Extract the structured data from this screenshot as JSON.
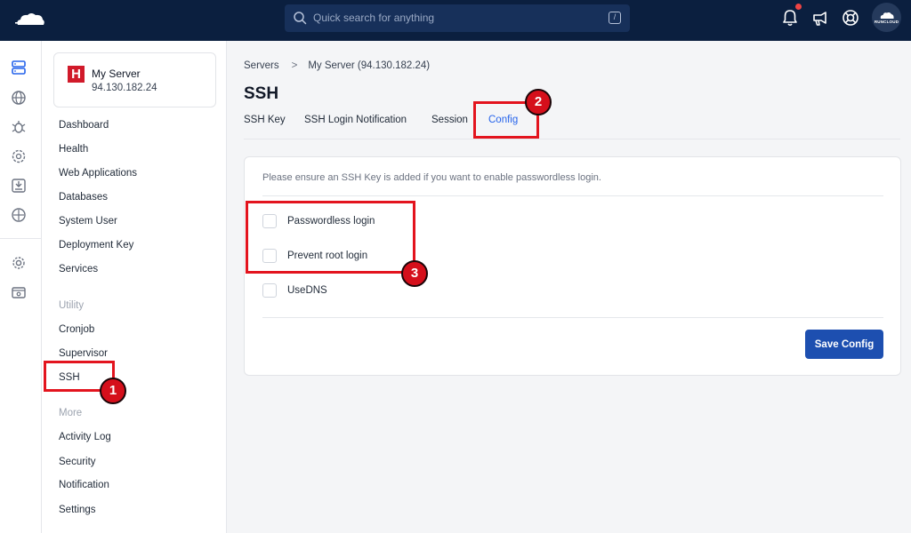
{
  "topbar": {
    "search_placeholder": "Quick search for anything",
    "search_shortcut": "/",
    "avatar_text": "RUNCLOUD",
    "notification_dot_color": "#ef4444"
  },
  "server": {
    "name": "My Server",
    "ip": "94.130.182.24",
    "logo_letter": "H",
    "logo_color": "#d11a2a"
  },
  "sidebar": {
    "items": [
      {
        "label": "Dashboard"
      },
      {
        "label": "Health"
      },
      {
        "label": "Web Applications"
      },
      {
        "label": "Databases"
      },
      {
        "label": "System User"
      },
      {
        "label": "Deployment Key"
      },
      {
        "label": "Services"
      }
    ],
    "utility_label": "Utility",
    "utility_items": [
      {
        "label": "Cronjob"
      },
      {
        "label": "Supervisor"
      },
      {
        "label": "SSH"
      }
    ],
    "more_label": "More",
    "more_items": [
      {
        "label": "Activity Log"
      },
      {
        "label": "Security"
      },
      {
        "label": "Notification"
      },
      {
        "label": "Settings"
      }
    ]
  },
  "breadcrumb": {
    "root": "Servers",
    "current": "My Server (94.130.182.24)"
  },
  "page": {
    "title": "SSH"
  },
  "tabs": [
    {
      "label": "SSH Key"
    },
    {
      "label": "SSH Login Notification"
    },
    {
      "label": "Session"
    },
    {
      "label": "Config",
      "active": true
    }
  ],
  "config": {
    "info": "Please ensure an SSH Key is added if you want to enable passwordless login.",
    "options": [
      {
        "label": "Passwordless login",
        "checked": false
      },
      {
        "label": "Prevent root login",
        "checked": false
      },
      {
        "label": "UseDNS",
        "checked": false
      }
    ],
    "save_label": "Save Config"
  },
  "annotations": [
    {
      "label": "1"
    },
    {
      "label": "2"
    },
    {
      "label": "3"
    }
  ],
  "colors": {
    "topbar": "#0b1f3f",
    "accent": "#2563eb",
    "button": "#1d4fb0",
    "annotation": "#e3141e"
  }
}
